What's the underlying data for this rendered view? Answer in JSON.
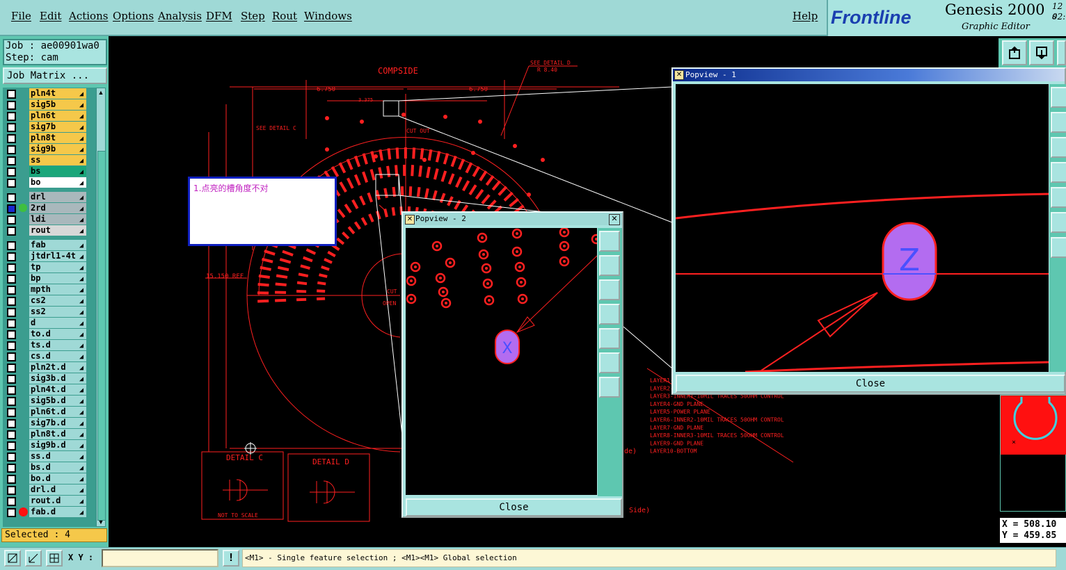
{
  "menu": {
    "file": "File",
    "edit": "Edit",
    "actions": "Actions",
    "options": "Options",
    "analysis": "Analysis",
    "dfm": "DFM",
    "step": "Step",
    "rout": "Rout",
    "windows": "Windows",
    "help": "Help"
  },
  "brand": {
    "logo": "Frontline",
    "product": "Genesis 2000",
    "subtitle": "Graphic Editor",
    "corner_top": "12 s",
    "corner_bottom": "02:"
  },
  "job": {
    "job_line": "Job : ae00901wa0",
    "step_line": "Step: cam",
    "matrix_button": "Job Matrix ..."
  },
  "layers_group1": [
    {
      "name": "pln4t",
      "color": "#f5c84a"
    },
    {
      "name": "sig5b",
      "color": "#f5c84a"
    },
    {
      "name": "pln6t",
      "color": "#f5c84a"
    },
    {
      "name": "sig7b",
      "color": "#f5c84a"
    },
    {
      "name": "pln8t",
      "color": "#f5c84a"
    },
    {
      "name": "sig9b",
      "color": "#f5c84a"
    },
    {
      "name": "ss",
      "color": "#f5c84a"
    },
    {
      "name": "bs",
      "color": "#1aa67a"
    },
    {
      "name": "bo",
      "color": "#ffffff"
    }
  ],
  "layers_group2": [
    {
      "name": "drl",
      "color": "#a9b8bc"
    },
    {
      "name": "2rd",
      "color": "#a9b8bc"
    },
    {
      "name": "ldi",
      "color": "#a9b8bc"
    },
    {
      "name": "rout",
      "color": "#d8d8d8"
    }
  ],
  "layers_group3": [
    {
      "name": "fab"
    },
    {
      "name": "jtdrl1-4t"
    },
    {
      "name": "tp"
    },
    {
      "name": "bp"
    },
    {
      "name": "mpth"
    },
    {
      "name": "cs2"
    },
    {
      "name": "ss2"
    },
    {
      "name": "d"
    },
    {
      "name": "to.d"
    },
    {
      "name": "ts.d"
    },
    {
      "name": "cs.d"
    },
    {
      "name": "pln2t.d"
    },
    {
      "name": "sig3b.d"
    },
    {
      "name": "pln4t.d"
    },
    {
      "name": "sig5b.d"
    },
    {
      "name": "pln6t.d"
    },
    {
      "name": "sig7b.d"
    },
    {
      "name": "pln8t.d"
    },
    {
      "name": "sig9b.d"
    },
    {
      "name": "ss.d"
    },
    {
      "name": "bs.d"
    },
    {
      "name": "bo.d"
    },
    {
      "name": "drl.d"
    },
    {
      "name": "rout.d"
    },
    {
      "name": "fab.d"
    }
  ],
  "selected_text": "Selected : 4",
  "xy_label": "X Y :",
  "xy_input_value": "",
  "status_message": "<M1> - Single feature selection ; <M1><M1> Global selection",
  "coords": {
    "x": "X = 508.10",
    "y": "Y = 459.85"
  },
  "note": {
    "text": "1.点亮的槽角度不对"
  },
  "popview1": {
    "title": "Popview - 1",
    "close": "Close",
    "marker": "Z"
  },
  "popview2": {
    "title": "Popview - 2",
    "close": "Close",
    "marker": "X"
  },
  "drawing": {
    "compside": "COMPSIDE",
    "see_detail_d": "SEE DETAIL D",
    "r_label": "R 8.40",
    "dim_left": "6.750",
    "dim_right": "6.750",
    "dim_3375": "3.375",
    "see_detail_c": "SEE DETAIL C",
    "cut_out": "CUT OUT",
    "ref_label": "15.150 REF",
    "detail_c": "DETAIL C",
    "detail_d": "DETAIL D",
    "not_to_scale": "NOT TO SCALE",
    "cut": "CUT",
    "open": "OPEN",
    "stack": [
      "LAYER1-",
      "LAYER2-",
      "LAYER3-INNER1-10MIL TRACES 50OHM CONTROL",
      "LAYER4-GND PLANE",
      "LAYER5-POWER PLANE",
      "LAYER6-INNER2-10MIL TRACES 50OHM CONTROL",
      "LAYER7-GND PLANE",
      "LAYER8-INNER3-10MIL TRACES 50OHM CONTROL",
      "LAYER9-GND PLANE",
      "LAYER10-BOTTOM"
    ],
    "side_label": "Side)",
    "de_label": "de)"
  },
  "colors": {
    "panel": "#9fd9d6",
    "accent": "#5ec7b0",
    "drawing": "#ff2020",
    "slot": "#b36cf0",
    "selected": "#f5c84a"
  }
}
